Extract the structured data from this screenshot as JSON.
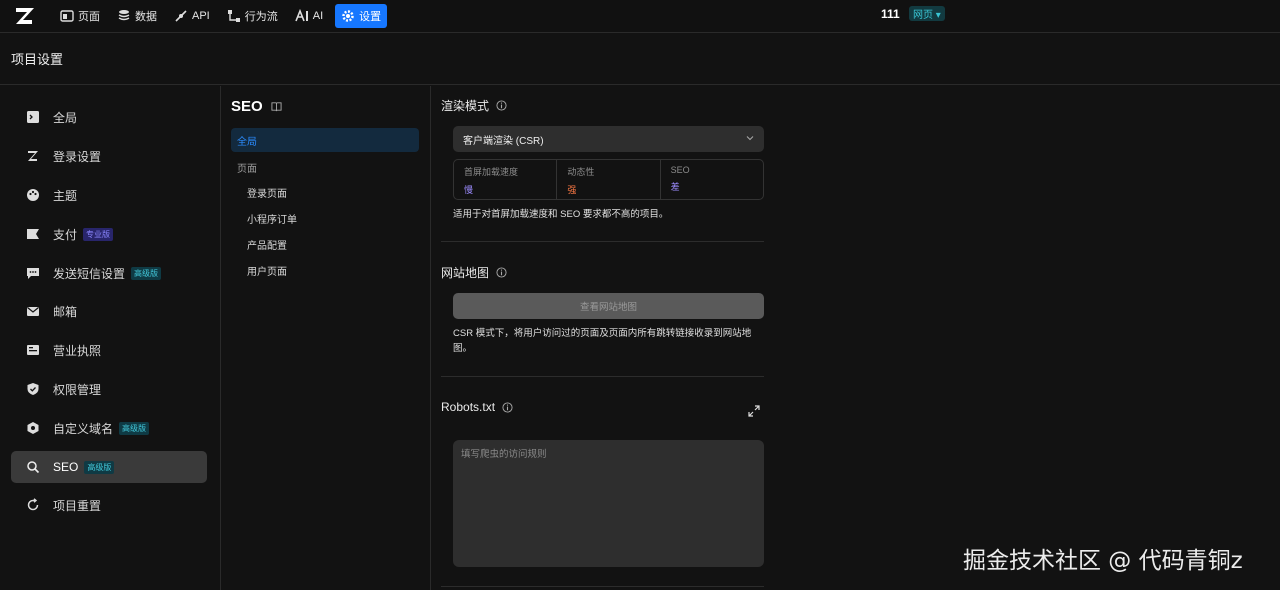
{
  "topbar": {
    "nav": [
      {
        "label": "页面",
        "icon": "page-icon"
      },
      {
        "label": "数据",
        "icon": "database-icon"
      },
      {
        "label": "API",
        "icon": "api-icon"
      },
      {
        "label": "行为流",
        "icon": "flow-icon"
      },
      {
        "label": "AI",
        "icon": "ai-icon"
      },
      {
        "label": "设置",
        "icon": "gear-icon",
        "active": true
      }
    ],
    "project_name": "111",
    "env_label": "网页 ▾"
  },
  "header": {
    "title": "项目设置"
  },
  "sidebar": {
    "items": [
      {
        "label": "全局",
        "icon": "terminal-icon"
      },
      {
        "label": "登录设置",
        "icon": "login-icon"
      },
      {
        "label": "主题",
        "icon": "palette-icon"
      },
      {
        "label": "支付",
        "icon": "payment-icon",
        "badge": "专业版"
      },
      {
        "label": "发送短信设置",
        "icon": "sms-icon",
        "badge": "高级版"
      },
      {
        "label": "邮箱",
        "icon": "mail-icon"
      },
      {
        "label": "营业执照",
        "icon": "license-icon"
      },
      {
        "label": "权限管理",
        "icon": "shield-icon"
      },
      {
        "label": "自定义域名",
        "icon": "domain-icon",
        "badge": "高级版"
      },
      {
        "label": "SEO",
        "icon": "search-icon",
        "badge": "高级版",
        "active": true
      },
      {
        "label": "项目重置",
        "icon": "reset-icon"
      }
    ]
  },
  "sub_panel": {
    "title": "SEO",
    "global_label": "全局",
    "group_label": "页面",
    "pages": [
      "登录页面",
      "小程序订单",
      "产品配置",
      "用户页面"
    ]
  },
  "render_mode": {
    "title": "渲染模式",
    "selected": "客户端渲染 (CSR)",
    "metrics": [
      {
        "label": "首屏加载速度",
        "value": "慢",
        "color": "#9c8cff"
      },
      {
        "label": "动态性",
        "value": "强",
        "color": "#ff7a45"
      },
      {
        "label": "SEO",
        "value": "差",
        "color": "#9c8cff"
      }
    ],
    "description": "适用于对首屏加载速度和 SEO 要求都不高的项目。"
  },
  "sitemap": {
    "title": "网站地图",
    "button_label": "查看网站地图",
    "description": "CSR 模式下，将用户访问过的页面及页面内所有跳转链接收录到网站地图。"
  },
  "robots": {
    "title": "Robots.txt",
    "placeholder": "填写爬虫的访问规则",
    "value": ""
  },
  "watermark": "掘金技术社区 @ 代码青铜z",
  "colors": {
    "accent": "#1677ff",
    "background": "#121212"
  }
}
